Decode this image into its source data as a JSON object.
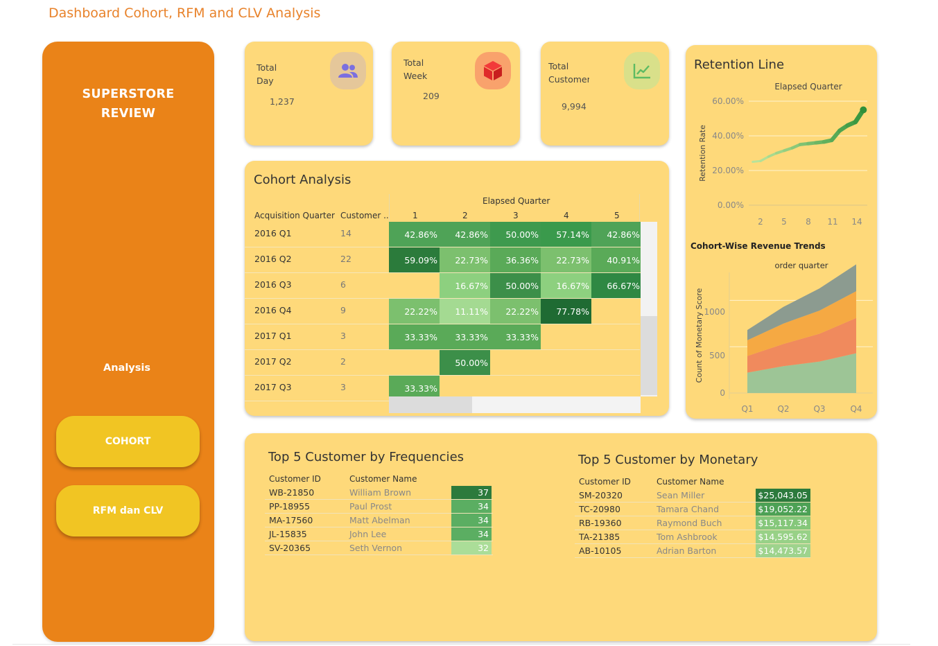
{
  "page": {
    "title": "Dashboard Cohort, RFM and CLV Analysis"
  },
  "sidebar": {
    "brand_line1": "SUPERSTORE",
    "brand_line2": "REVIEW",
    "analysis_label": "Analysis",
    "buttons": [
      {
        "label": "COHORT"
      },
      {
        "label": "RFM dan CLV"
      }
    ]
  },
  "kpis": [
    {
      "label_line1": "Total",
      "label_line2": "Day",
      "value": "1,237",
      "icon": "users-icon",
      "icon_bg": "#E5C79A",
      "icon_color": "#7B6FE0"
    },
    {
      "label_line1": "Total",
      "label_line2": "Week",
      "value": "209",
      "icon": "box-icon",
      "icon_bg": "#F9A26C",
      "icon_color": "#E02A2A"
    },
    {
      "label_line1": "Total",
      "label_line2": "Customers",
      "value": "9,994",
      "icon": "chart-line-icon",
      "icon_bg": "#D9E08A",
      "icon_color": "#5DBB63"
    }
  ],
  "cohort": {
    "title": "Cohort Analysis",
    "col_group_label": "Elapsed Quarter",
    "row_header": "Acquisition Quarter",
    "count_header": "Customer ..",
    "quarters": [
      "1",
      "2",
      "3",
      "4",
      "5"
    ],
    "rows": [
      {
        "label": "2016 Q1",
        "count": "14",
        "cells": [
          "42.86%",
          "42.86%",
          "50.00%",
          "57.14%",
          "42.86%"
        ],
        "colors": [
          "#4FA357",
          "#4FA357",
          "#3E9A4E",
          "#3A9A4C",
          "#4FA357"
        ]
      },
      {
        "label": "2016 Q2",
        "count": "22",
        "cells": [
          "59.09%",
          "22.73%",
          "36.36%",
          "22.73%",
          "40.91%"
        ],
        "colors": [
          "#2B7B3B",
          "#7CC06E",
          "#5AAA58",
          "#7CC06E",
          "#5AAA58"
        ]
      },
      {
        "label": "2016 Q3",
        "count": "6",
        "cells": [
          "",
          "16.67%",
          "50.00%",
          "16.67%",
          "66.67%"
        ],
        "colors": [
          "",
          "#8DD07F",
          "#3C8F49",
          "#8DD07F",
          "#2F8843"
        ]
      },
      {
        "label": "2016 Q4",
        "count": "9",
        "cells": [
          "22.22%",
          "11.11%",
          "22.22%",
          "77.78%",
          ""
        ],
        "colors": [
          "#7CC06E",
          "#A4DA92",
          "#7CC06E",
          "#1F6B33",
          ""
        ]
      },
      {
        "label": "2017 Q1",
        "count": "3",
        "cells": [
          "33.33%",
          "33.33%",
          "33.33%",
          "",
          ""
        ],
        "colors": [
          "#5AAA58",
          "#5AAA58",
          "#5AAA58",
          "",
          ""
        ]
      },
      {
        "label": "2017 Q2",
        "count": "2",
        "cells": [
          "",
          "50.00%",
          "",
          "",
          ""
        ],
        "colors": [
          "",
          "#3C8F49",
          "",
          "",
          ""
        ]
      },
      {
        "label": "2017 Q3",
        "count": "3",
        "cells": [
          "33.33%",
          "",
          "",
          "",
          ""
        ],
        "colors": [
          "#5AAA58",
          "",
          "",
          "",
          ""
        ]
      }
    ]
  },
  "retention": {
    "title": "Retention Line",
    "x_title": "Elapsed Quarter",
    "y_title": "Retention Rate",
    "y_ticks": [
      "60.00%",
      "40.00%",
      "20.00%",
      "0.00%"
    ],
    "x_ticks": [
      "2",
      "5",
      "8",
      "11",
      "14"
    ]
  },
  "revenue": {
    "title": "Cohort-Wise Revenue Trends",
    "x_title": "order quarter",
    "y_title": "Count of Monetary Score",
    "y_ticks": [
      "1000",
      "500",
      "0"
    ],
    "x_ticks": [
      "Q1",
      "Q2",
      "Q3",
      "Q4"
    ]
  },
  "chart_data": [
    {
      "type": "line",
      "title": "Retention Line",
      "xlabel": "Elapsed Quarter",
      "ylabel": "Retention Rate",
      "x": [
        1,
        2,
        3,
        4,
        5,
        6,
        7,
        8,
        9,
        10,
        11,
        12,
        13,
        14,
        15
      ],
      "values": [
        25,
        25.5,
        28,
        30,
        31.5,
        33,
        35,
        35.5,
        36,
        36.5,
        37.5,
        43,
        46,
        48,
        55
      ],
      "ylim": [
        0,
        60
      ],
      "grid": true
    },
    {
      "type": "area",
      "title": "Cohort-Wise Revenue Trends",
      "xlabel": "order quarter",
      "ylabel": "Count of Monetary Score",
      "categories": [
        "Q1",
        "Q2",
        "Q3",
        "Q4"
      ],
      "series": [
        {
          "color": "#9DC596",
          "values": [
            220,
            290,
            340,
            430
          ]
        },
        {
          "color": "#F08A5D",
          "values": [
            180,
            240,
            300,
            380
          ]
        },
        {
          "color": "#F5A943",
          "values": [
            170,
            220,
            250,
            290
          ]
        },
        {
          "color": "#8C9B90",
          "values": [
            110,
            180,
            240,
            290
          ]
        }
      ],
      "ylim": [
        0,
        1400
      ],
      "grid": true
    }
  ],
  "top_freq": {
    "title": "Top 5 Customer by Frequencies",
    "col_id": "Customer ID",
    "col_name": "Customer Name",
    "rows": [
      {
        "id": "WB-21850",
        "name": "William Brown",
        "value": "37",
        "color": "#2C7A3C"
      },
      {
        "id": "PP-18955",
        "name": "Paul Prost",
        "value": "34",
        "color": "#5BAE62"
      },
      {
        "id": "MA-17560",
        "name": "Matt Abelman",
        "value": "34",
        "color": "#5BAE62"
      },
      {
        "id": "JL-15835",
        "name": "John Lee",
        "value": "34",
        "color": "#5BAE62"
      },
      {
        "id": "SV-20365",
        "name": "Seth Vernon",
        "value": "32",
        "color": "#ABDD98"
      }
    ]
  },
  "top_monetary": {
    "title": "Top 5 Customer by Monetary",
    "col_id": "Customer ID",
    "col_name": "Customer Name",
    "rows": [
      {
        "id": "SM-20320",
        "name": "Sean Miller",
        "value": "$25,043.05",
        "color": "#2C7A3C"
      },
      {
        "id": "TC-20980",
        "name": "Tamara Chand",
        "value": "$19,052.22",
        "color": "#4DA155"
      },
      {
        "id": "RB-19360",
        "name": "Raymond Buch",
        "value": "$15,117.34",
        "color": "#85C77A"
      },
      {
        "id": "TA-21385",
        "name": "Tom Ashbrook",
        "value": "$14,595.62",
        "color": "#98D187"
      },
      {
        "id": "AB-10105",
        "name": "Adrian Barton",
        "value": "$14,473.57",
        "color": "#9ED38D"
      }
    ]
  }
}
